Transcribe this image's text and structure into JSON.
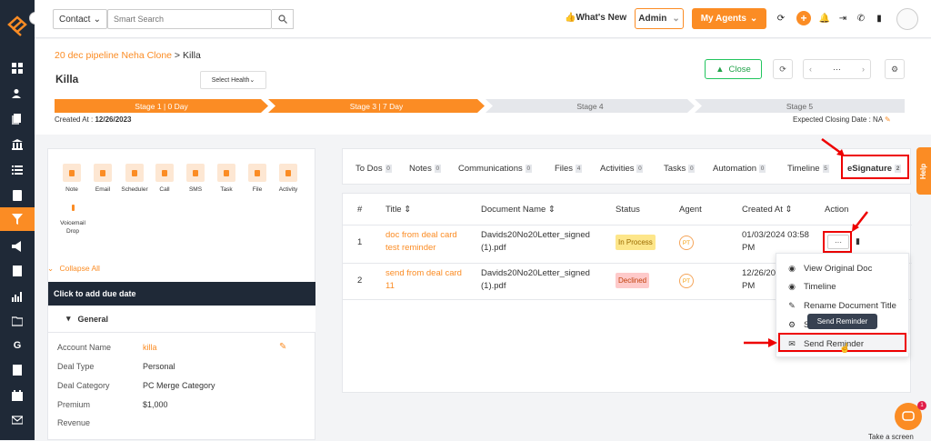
{
  "topbar": {
    "contact_label": "Contact",
    "search_placeholder": "Smart Search",
    "whats_new": "What's New",
    "admin_label": "Admin",
    "my_agents_label": "My Agents"
  },
  "header": {
    "breadcrumb_pipeline": "20 dec pipeline Neha Clone",
    "breadcrumb_sep": " > ",
    "breadcrumb_deal": "Killa",
    "deal_name": "Killa",
    "select_health": "Select Health",
    "close_label": "Close",
    "created_at_label": "Created At : ",
    "created_at_value": "12/26/2023",
    "closing_date": "Expected Closing Date : NA"
  },
  "stages": [
    {
      "label": "Stage 1 | 0 Day",
      "status": "done"
    },
    {
      "label": "Stage 3 | 7 Day",
      "status": "done"
    },
    {
      "label": "Stage 4",
      "status": "todo"
    },
    {
      "label": "Stage 5",
      "status": "todo"
    }
  ],
  "activities": [
    {
      "label": "Note"
    },
    {
      "label": "Email"
    },
    {
      "label": "Scheduler"
    },
    {
      "label": "Call"
    },
    {
      "label": "SMS"
    },
    {
      "label": "Task"
    },
    {
      "label": "File"
    },
    {
      "label": "Activity"
    },
    {
      "label": "Voicemail Drop"
    }
  ],
  "left": {
    "collapse_all": "Collapse All",
    "due_date": "Click to add due date",
    "general": "General",
    "fields": [
      {
        "key": "Account Name",
        "value": "killa"
      },
      {
        "key": "Deal Type",
        "value": "Personal"
      },
      {
        "key": "Deal Category",
        "value": "PC Merge Category"
      },
      {
        "key": "Premium",
        "value": "$1,000"
      },
      {
        "key": "Revenue",
        "value": ""
      }
    ]
  },
  "tabs": [
    {
      "label": "To Dos",
      "count": "0"
    },
    {
      "label": "Notes",
      "count": "0"
    },
    {
      "label": "Communications",
      "count": "0"
    },
    {
      "label": "Files",
      "count": "4"
    },
    {
      "label": "Activities",
      "count": "0"
    },
    {
      "label": "Tasks",
      "count": "0"
    },
    {
      "label": "Automation",
      "count": "0"
    },
    {
      "label": "Timeline",
      "count": "5"
    },
    {
      "label": "eSignature",
      "count": "2"
    }
  ],
  "table": {
    "headers": [
      "#",
      "Title",
      "Document Name",
      "Status",
      "Agent",
      "Created At",
      "Action"
    ],
    "rows": [
      {
        "num": "1",
        "title1": "doc from deal card",
        "title2": "test reminder",
        "doc1": "Davids20No20Letter_signed",
        "doc2": "(1).pdf",
        "status": "In Process",
        "agent": "PT",
        "created1": "01/03/2024 03:58",
        "created2": "PM"
      },
      {
        "num": "2",
        "title1": "send from deal card",
        "title2": "11",
        "doc1": "Davids20No20Letter_signed",
        "doc2": "(1).pdf",
        "status": "Declined",
        "agent": "PT",
        "created1": "12/26/20",
        "created2": "PM"
      }
    ]
  },
  "menu": {
    "items": [
      "View Original Doc",
      "Timeline",
      "Rename Document Title",
      "S",
      "Send Reminder"
    ],
    "tooltip": "Send Reminder"
  },
  "help_label": "Help",
  "chat_badge": "1",
  "take_text": "Take a screen"
}
